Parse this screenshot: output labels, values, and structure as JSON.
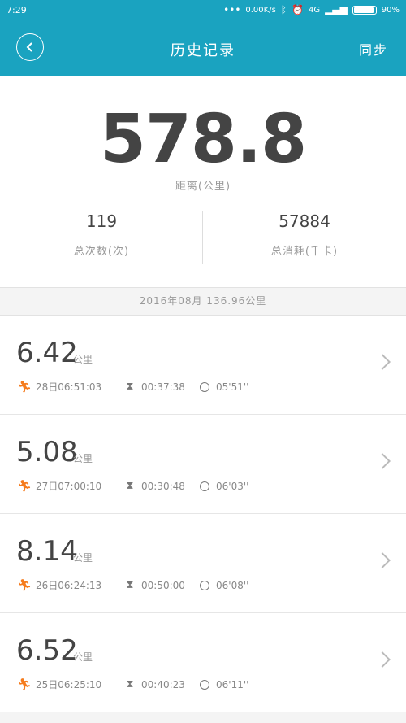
{
  "status": {
    "time": "7:29",
    "speed": "0.00K/s",
    "net": "4G",
    "battery": "90%"
  },
  "header": {
    "title": "历史记录",
    "action": "同步"
  },
  "summary": {
    "total_distance": "578.8",
    "distance_label": "距离(公里)",
    "count_value": "119",
    "count_label": "总次数(次)",
    "calories_value": "57884",
    "calories_label": "总消耗(千卡)"
  },
  "month_header": "2016年08月  136.96公里",
  "records": [
    {
      "distance": "6.42",
      "unit": "公里",
      "start": "28日06:51:03",
      "duration": "00:37:38",
      "pace": "05'51''"
    },
    {
      "distance": "5.08",
      "unit": "公里",
      "start": "27日07:00:10",
      "duration": "00:30:48",
      "pace": "06'03''"
    },
    {
      "distance": "8.14",
      "unit": "公里",
      "start": "26日06:24:13",
      "duration": "00:50:00",
      "pace": "06'08''"
    },
    {
      "distance": "6.52",
      "unit": "公里",
      "start": "25日06:25:10",
      "duration": "00:40:23",
      "pace": "06'11''"
    }
  ],
  "icons": {
    "back": "back-arrow-icon",
    "run": "runner-icon",
    "duration": "hourglass-icon",
    "pace": "stopwatch-icon",
    "chevron": "chevron-right-icon"
  },
  "colors": {
    "header": "#1aa3c0",
    "run_icon": "#f57c1e"
  }
}
